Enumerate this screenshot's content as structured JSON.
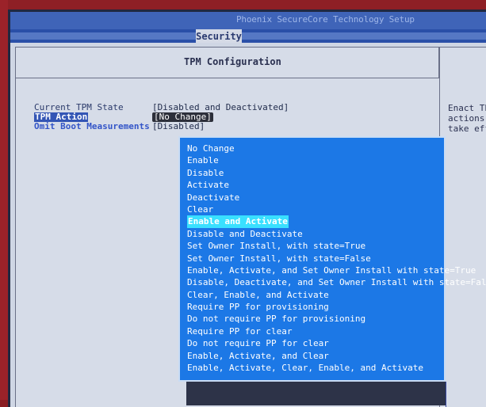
{
  "header": {
    "vendor": "Phoenix SecureCore Technology Setup",
    "active_tab": "Security"
  },
  "panel": {
    "title": "TPM Configuration",
    "help_text": "Enact TPM\nactions r\ntake effe"
  },
  "settings": [
    {
      "label": "Current TPM State",
      "value": "[Disabled and Deactivated]"
    },
    {
      "label": "TPM Action",
      "value": "[No Change]"
    },
    {
      "label": "Omit Boot Measurements",
      "value": "[Disabled]"
    }
  ],
  "popup": {
    "selected_index": 6,
    "options": [
      "No Change",
      "Enable",
      "Disable",
      "Activate",
      "Deactivate",
      "Clear",
      "Enable and Activate",
      "Disable and Deactivate",
      "Set Owner Install, with state=True",
      "Set Owner Install, with state=False",
      "Enable, Activate, and Set Owner Install with state=True",
      "Disable, Deactivate, and Set Owner Install with state=False",
      "Clear, Enable, and Activate",
      "Require PP for provisioning",
      "Do not require PP for provisioning",
      "Require PP for clear",
      "Do not require PP for clear",
      "Enable, Activate, and Clear",
      "Enable, Activate, Clear, Enable, and Activate"
    ]
  },
  "colors": {
    "popup_bg": "#1c78e6",
    "highlight": "#39e0ff",
    "header_blue": "#3f64b8"
  }
}
